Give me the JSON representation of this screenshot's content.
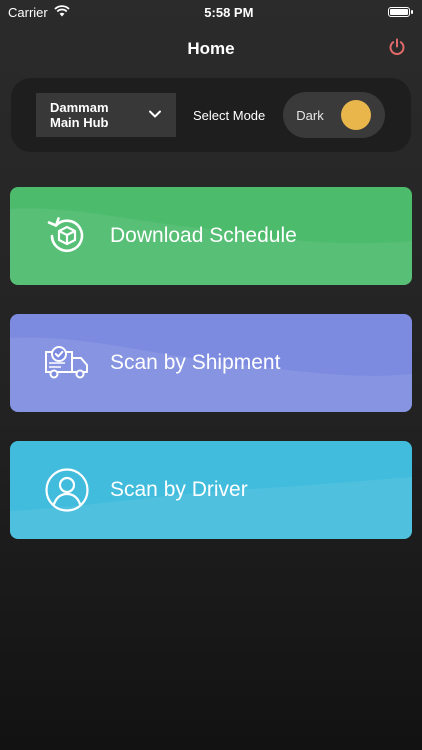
{
  "status_bar": {
    "carrier": "Carrier",
    "time": "5:58 PM",
    "icons": [
      "wifi-icon",
      "battery-icon"
    ]
  },
  "header": {
    "title": "Home",
    "power_icon": "power-icon"
  },
  "controls": {
    "hub": {
      "label": "Dammam\nMain Hub",
      "icon": "chevron-down-icon"
    },
    "mode": {
      "label": "Select Mode",
      "toggle_label": "Dark",
      "toggle_on": true
    }
  },
  "cards": [
    {
      "label": "Download Schedule",
      "icon": "download-box-icon",
      "color": "#4cbb6c"
    },
    {
      "label": "Scan by Shipment",
      "icon": "delivery-truck-icon",
      "color": "#7c8be0"
    },
    {
      "label": "Scan by Driver",
      "icon": "user-circle-icon",
      "color": "#41bcdc"
    }
  ],
  "colors": {
    "power_accent": "#e36a6a",
    "toggle_knob": "#e9b64b",
    "background": "#222222"
  }
}
